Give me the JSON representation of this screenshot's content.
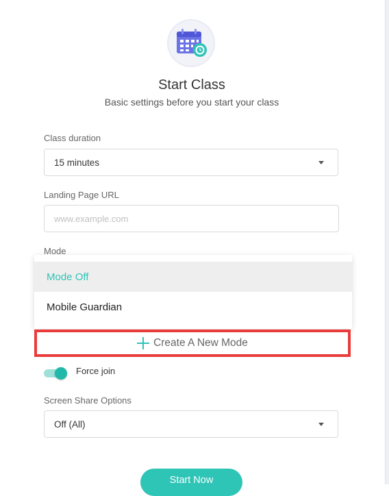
{
  "header": {
    "icon": "calendar-gear-icon",
    "title": "Start Class",
    "subtitle": "Basic settings before you start your class"
  },
  "form": {
    "class_duration": {
      "label": "Class duration",
      "value": "15 minutes"
    },
    "landing_page": {
      "label": "Landing Page URL",
      "placeholder": "www.example.com",
      "value": ""
    },
    "mode": {
      "label": "Mode",
      "options": [
        {
          "label": "Mode Off",
          "selected": true
        },
        {
          "label": "Mobile Guardian",
          "selected": false
        }
      ],
      "create_label": "Create A New Mode"
    },
    "force_join": {
      "label": "Force join",
      "enabled": true
    },
    "screen_share": {
      "label": "Screen Share Options",
      "value": "Off (All)"
    }
  },
  "actions": {
    "start_label": "Start Now"
  },
  "colors": {
    "accent": "#2ec4b6",
    "highlight_border": "#ea3b3b",
    "icon_purple": "#6b73e6"
  }
}
